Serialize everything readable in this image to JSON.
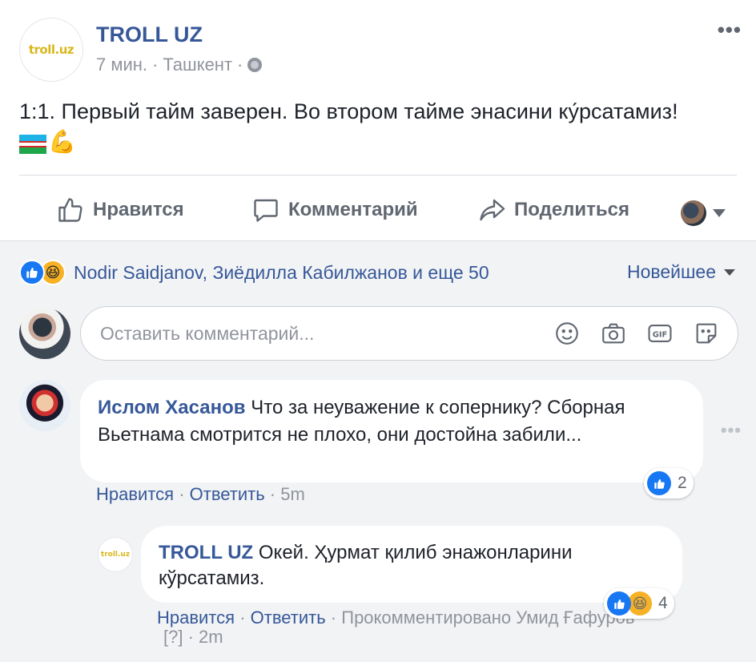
{
  "post": {
    "page_name": "TROLL UZ",
    "avatar_text": "troll.uz",
    "time": "7 мин.",
    "location": "Ташкент",
    "separator": "·",
    "text": "1:1. Первый тайм заверен. Во втором тайме энасини ку́рсатамиз!",
    "emoji_muscle": "💪",
    "more_icon": "•••"
  },
  "actions": {
    "like": "Нравится",
    "comment": "Комментарий",
    "share": "Поделиться"
  },
  "reactions": {
    "summary": "Nodir Saidjanov, Зиёдилла Кабилжанов и еще 50",
    "sort_label": "Новейшее",
    "haha_emoji": "😆"
  },
  "composer": {
    "placeholder": "Оставить комментарий..."
  },
  "comments": [
    {
      "author": "Ислом Хасанов",
      "text": "Что за неуважение к сопернику? Сборная Вьетнама смотрится не плохо, они достойна забили...",
      "like_label": "Нравится",
      "reply_label": "Ответить",
      "time": "5m",
      "reaction_count": "2",
      "more_icon": "•••"
    },
    {
      "author": "TROLL UZ",
      "avatar_text": "troll.uz",
      "text": "Окей. Ҳурмат қилиб энажонларини кўрсатамиз.",
      "like_label": "Нравится",
      "reply_label": "Ответить",
      "commented_by": "Прокомментировано Умид Ғафуров",
      "flag": "[?]",
      "time": "2m",
      "reaction_count": "4"
    }
  ],
  "colors": {
    "link": "#365899",
    "meta": "#90949c",
    "like_blue": "#1877f2",
    "haha_yellow": "#f7b125",
    "comments_bg": "#f2f3f5"
  }
}
